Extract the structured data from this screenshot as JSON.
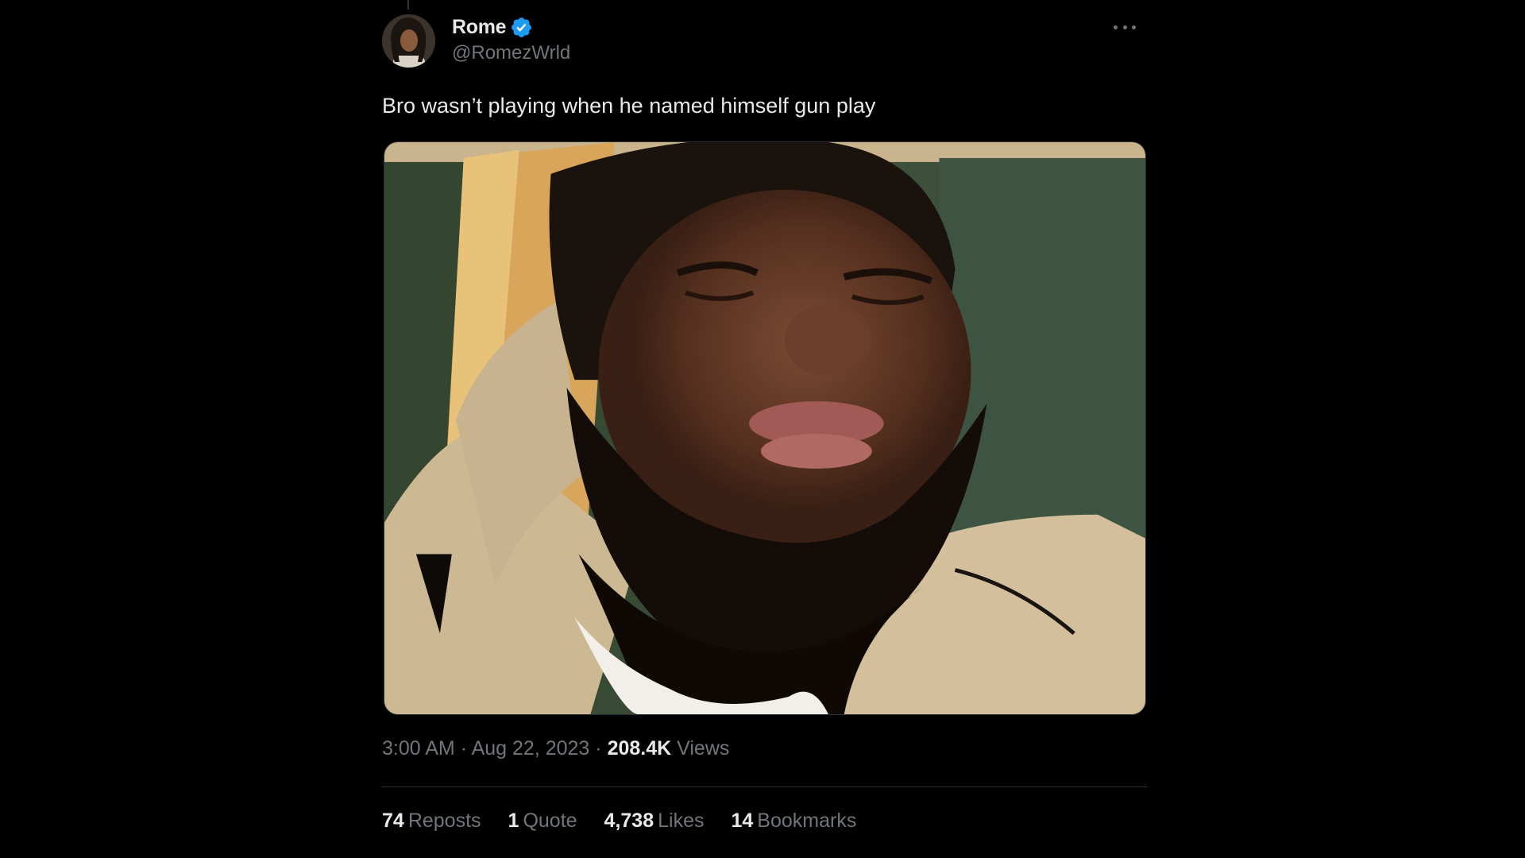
{
  "author": {
    "display_name": "Rome",
    "handle": "@RomezWrld",
    "verified": true,
    "verified_icon": "verified-badge-icon",
    "verified_color": "#1d9bf0"
  },
  "tweet": {
    "text": "Bro wasn’t playing when he named himself gun play"
  },
  "meta": {
    "time": "3:00 AM",
    "separator": "·",
    "date": "Aug 22, 2023",
    "views_count": "208.4K",
    "views_label": "Views"
  },
  "stats": [
    {
      "count": "74",
      "label": "Reposts"
    },
    {
      "count": "1",
      "label": "Quote"
    },
    {
      "count": "4,738",
      "label": "Likes"
    },
    {
      "count": "14",
      "label": "Bookmarks"
    }
  ],
  "icons": {
    "more": "more-horizontal-icon"
  },
  "colors": {
    "background": "#000000",
    "text_primary": "#e7e9ea",
    "text_secondary": "#71767b",
    "divider": "#2f3336"
  }
}
